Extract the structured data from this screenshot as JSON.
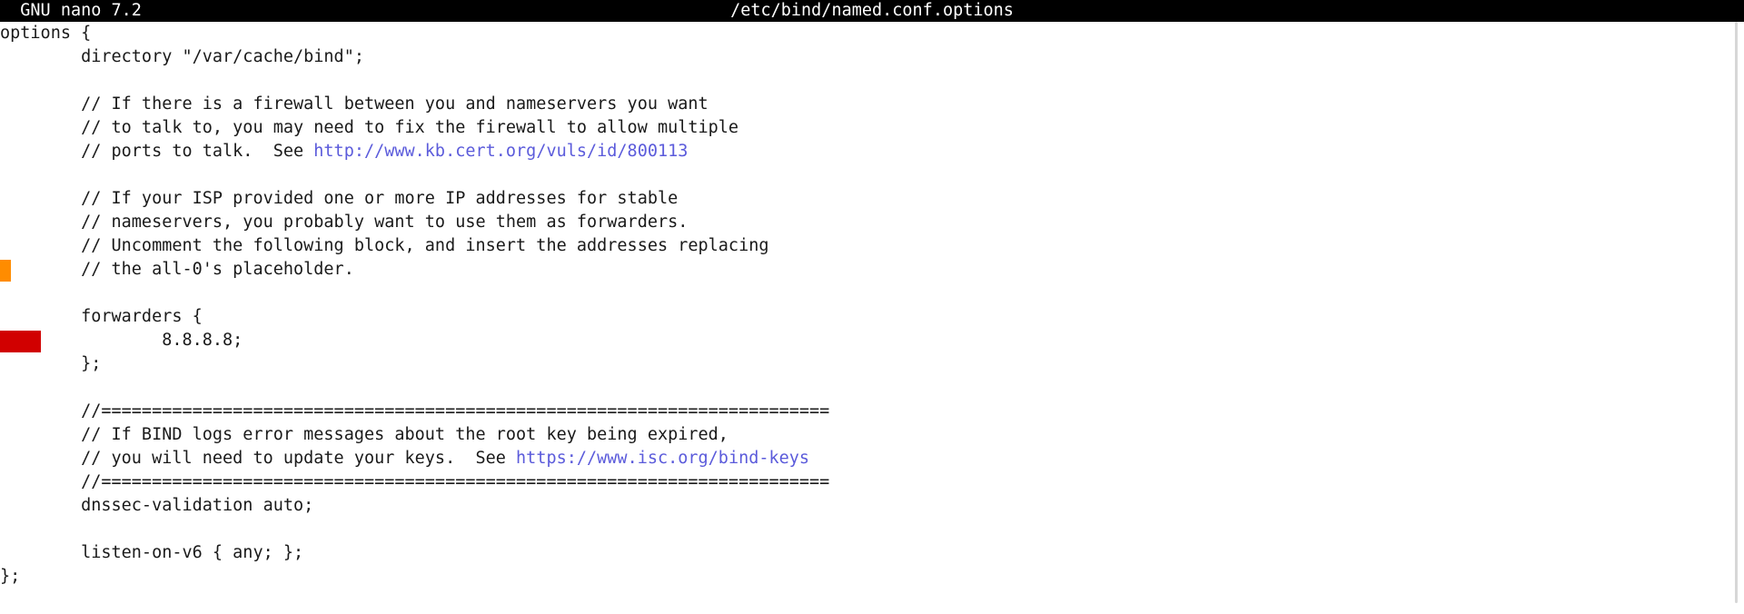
{
  "app": {
    "title": "GNU nano 7.2",
    "filename": "/etc/bind/named.conf.options"
  },
  "colors": {
    "titlebar_bg": "#000000",
    "link": "#5b5bdb",
    "marker_orange": "#ff8c00",
    "marker_red": "#d10000"
  },
  "lines": [
    {
      "text": "options {"
    },
    {
      "text": "        directory \"/var/cache/bind\";"
    },
    {
      "text": ""
    },
    {
      "text": "        // If there is a firewall between you and nameservers you want"
    },
    {
      "text": "        // to talk to, you may need to fix the firewall to allow multiple"
    },
    {
      "text": "        // ports to talk.  See ",
      "link": "http://www.kb.cert.org/vuls/id/800113"
    },
    {
      "text": ""
    },
    {
      "text": "        // If your ISP provided one or more IP addresses for stable"
    },
    {
      "text": "        // nameservers, you probably want to use them as forwarders."
    },
    {
      "text": "        // Uncomment the following block, and insert the addresses replacing"
    },
    {
      "text": "        // the all-0's placeholder.",
      "marker": "orange"
    },
    {
      "text": ""
    },
    {
      "text": "        forwarders {"
    },
    {
      "text": "                8.8.8.8;",
      "marker": "red"
    },
    {
      "text": "        };"
    },
    {
      "text": ""
    },
    {
      "text": "        //========================================================================"
    },
    {
      "text": "        // If BIND logs error messages about the root key being expired,"
    },
    {
      "text": "        // you will need to update your keys.  See ",
      "link": "https://www.isc.org/bind-keys"
    },
    {
      "text": "        //========================================================================"
    },
    {
      "text": "        dnssec-validation auto;"
    },
    {
      "text": ""
    },
    {
      "text": "        listen-on-v6 { any; };"
    },
    {
      "text": "};"
    }
  ]
}
